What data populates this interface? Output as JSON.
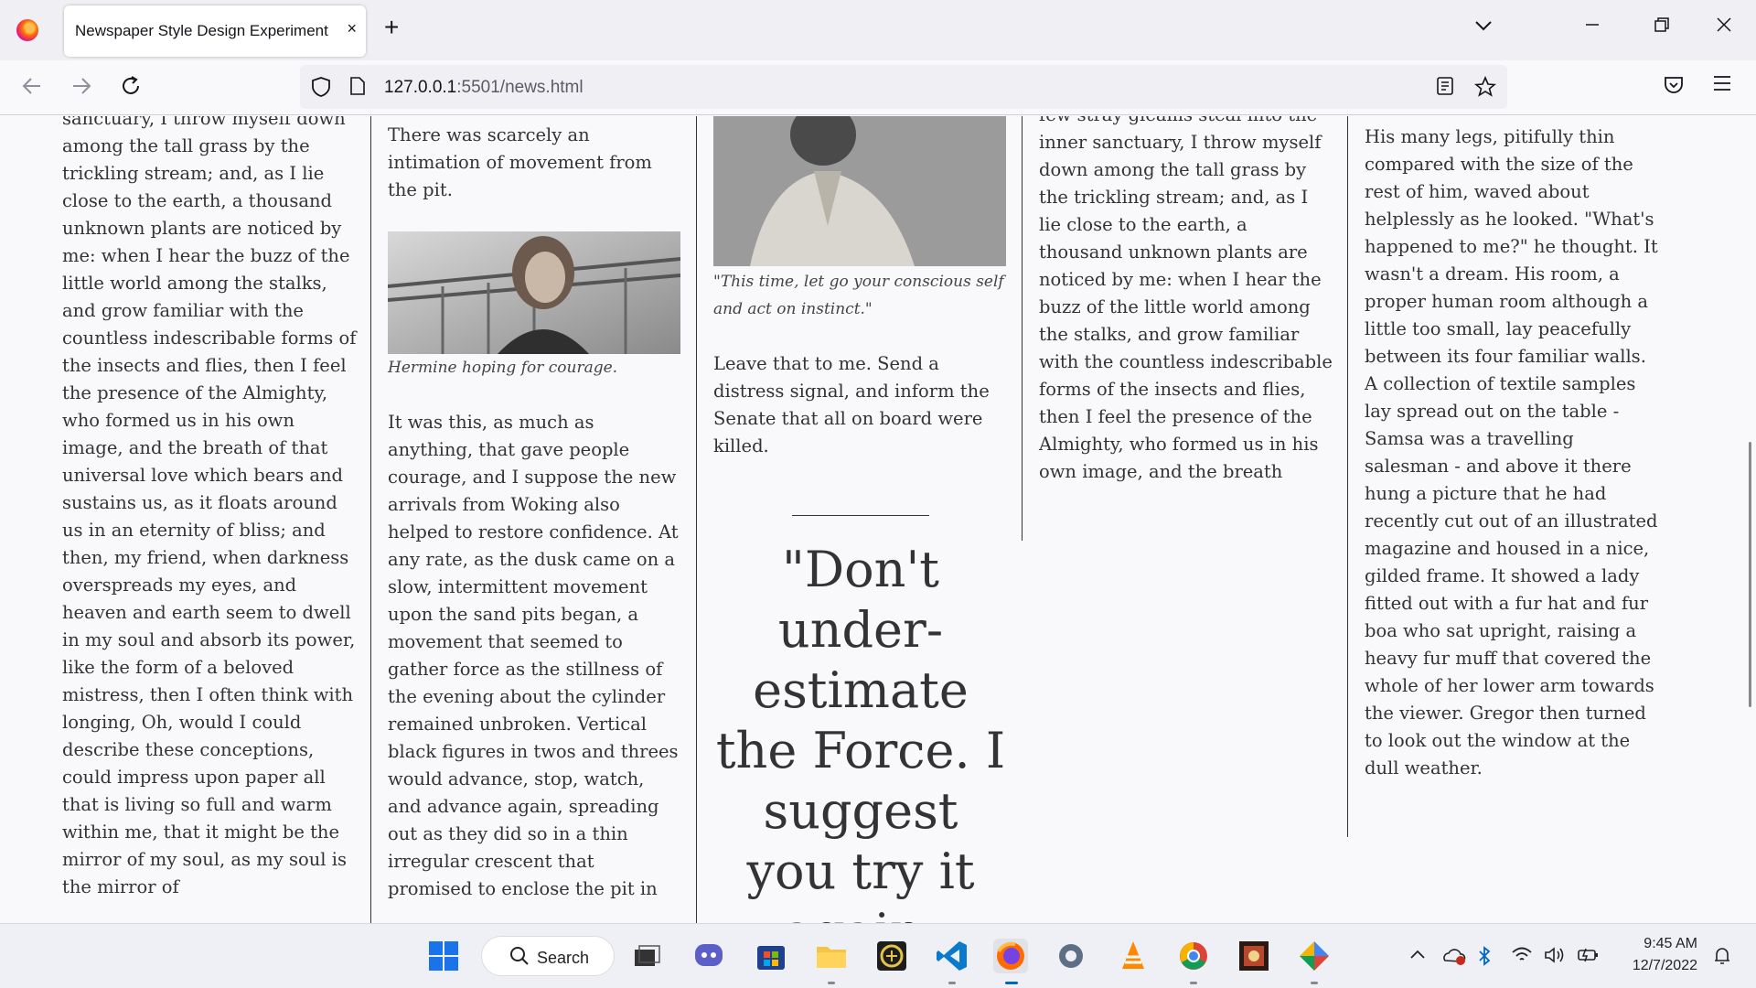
{
  "browser": {
    "tab_title": "Newspaper Style Design Experiment",
    "tab_close": "×",
    "new_tab": "+",
    "url_host": "127.0.0.1",
    "url_rest": ":5501/news.html",
    "icons": [
      "firefox-logo",
      "back-icon",
      "forward-icon",
      "reload-icon",
      "shield-icon",
      "page-icon",
      "reader-view-icon",
      "bookmark-star-icon",
      "pocket-icon",
      "menu-icon",
      "list-tabs-icon",
      "minimize-icon",
      "restore-icon",
      "close-icon"
    ]
  },
  "article": {
    "col1": "sanctuary, I throw myself down among the tall grass by the trickling stream; and, as I lie close to the earth, a thousand unknown plants are noticed by me: when I hear the buzz of the little world among the stalks, and grow familiar with the countless indescribable forms of the insects and flies, then I feel the presence of the Almighty, who formed us in his own image, and the breath of that universal love which bears and sustains us, as it floats around us in an eternity of bliss; and then, my friend, when darkness overspreads my eyes, and heaven and earth seem to dwell in my soul and absorb its power, like the form of a beloved mistress, then I often think with longing, Oh, would I could describe these conceptions, could impress upon paper all that is living so full and warm within me, that it might be the mirror of my soul, as my soul is the mirror of",
    "col2_top": "There was scarcely an intimation of movement from the pit.",
    "col2_caption": "Hermine hoping for courage.",
    "col2_body": "It was this, as much as anything, that gave people courage, and I suppose the new arrivals from Woking also helped to restore confidence. At any rate, as the dusk came on a slow, intermittent movement upon the sand pits began, a movement that seemed to gather force as the stillness of the evening about the cylinder remained unbroken. Vertical black figures in twos and threes would advance, stop, watch, and advance again, spreading out as they did so in a thin irregular crescent that promised to enclose the pit in",
    "col3_caption": "\"This time, let go your conscious self and act on instinct.\"",
    "col3_body": "Leave that to me. Send a distress signal, and inform the Senate that all on board were killed.",
    "pull_quote": "\"Don't under-estimate the Force. I suggest you try it again, Luke.\"",
    "col4": "few stray gleams steal into the inner sanctuary, I throw myself down among the tall grass by the trickling stream; and, as I lie close to the earth, a thousand unknown plants are noticed by me: when I hear the buzz of the little world among the stalks, and grow familiar with the countless indescribable forms of the insects and flies, then I feel the presence of the Almighty, who formed us in his own image, and the breath",
    "col5": "His many legs, pitifully thin compared with the size of the rest of him, waved about helplessly as he looked. \"What's happened to me?\" he thought. It wasn't a dream. His room, a proper human room although a little too small, lay peacefully between its four familiar walls. A collection of textile samples lay spread out on the table - Samsa was a travelling salesman - and above it there hung a picture that he had recently cut out of an illustrated magazine and housed in a nice, gilded frame. It showed a lady fitted out with a fur hat and fur boa who sat upright, raising a heavy fur muff that covered the whole of her lower arm towards the viewer. Gregor then turned to look out the window at the dull weather."
  },
  "taskbar": {
    "search_label": "Search",
    "time": "9:45 AM",
    "date": "12/7/2022",
    "apps": [
      "start-icon",
      "search-icon",
      "task-view-icon",
      "chat-icon",
      "store-icon",
      "file-explorer-icon",
      "app-icon",
      "vscode-icon",
      "firefox-icon",
      "settings-icon",
      "vlc-icon",
      "chrome-icon",
      "app2-icon",
      "app3-icon"
    ]
  }
}
